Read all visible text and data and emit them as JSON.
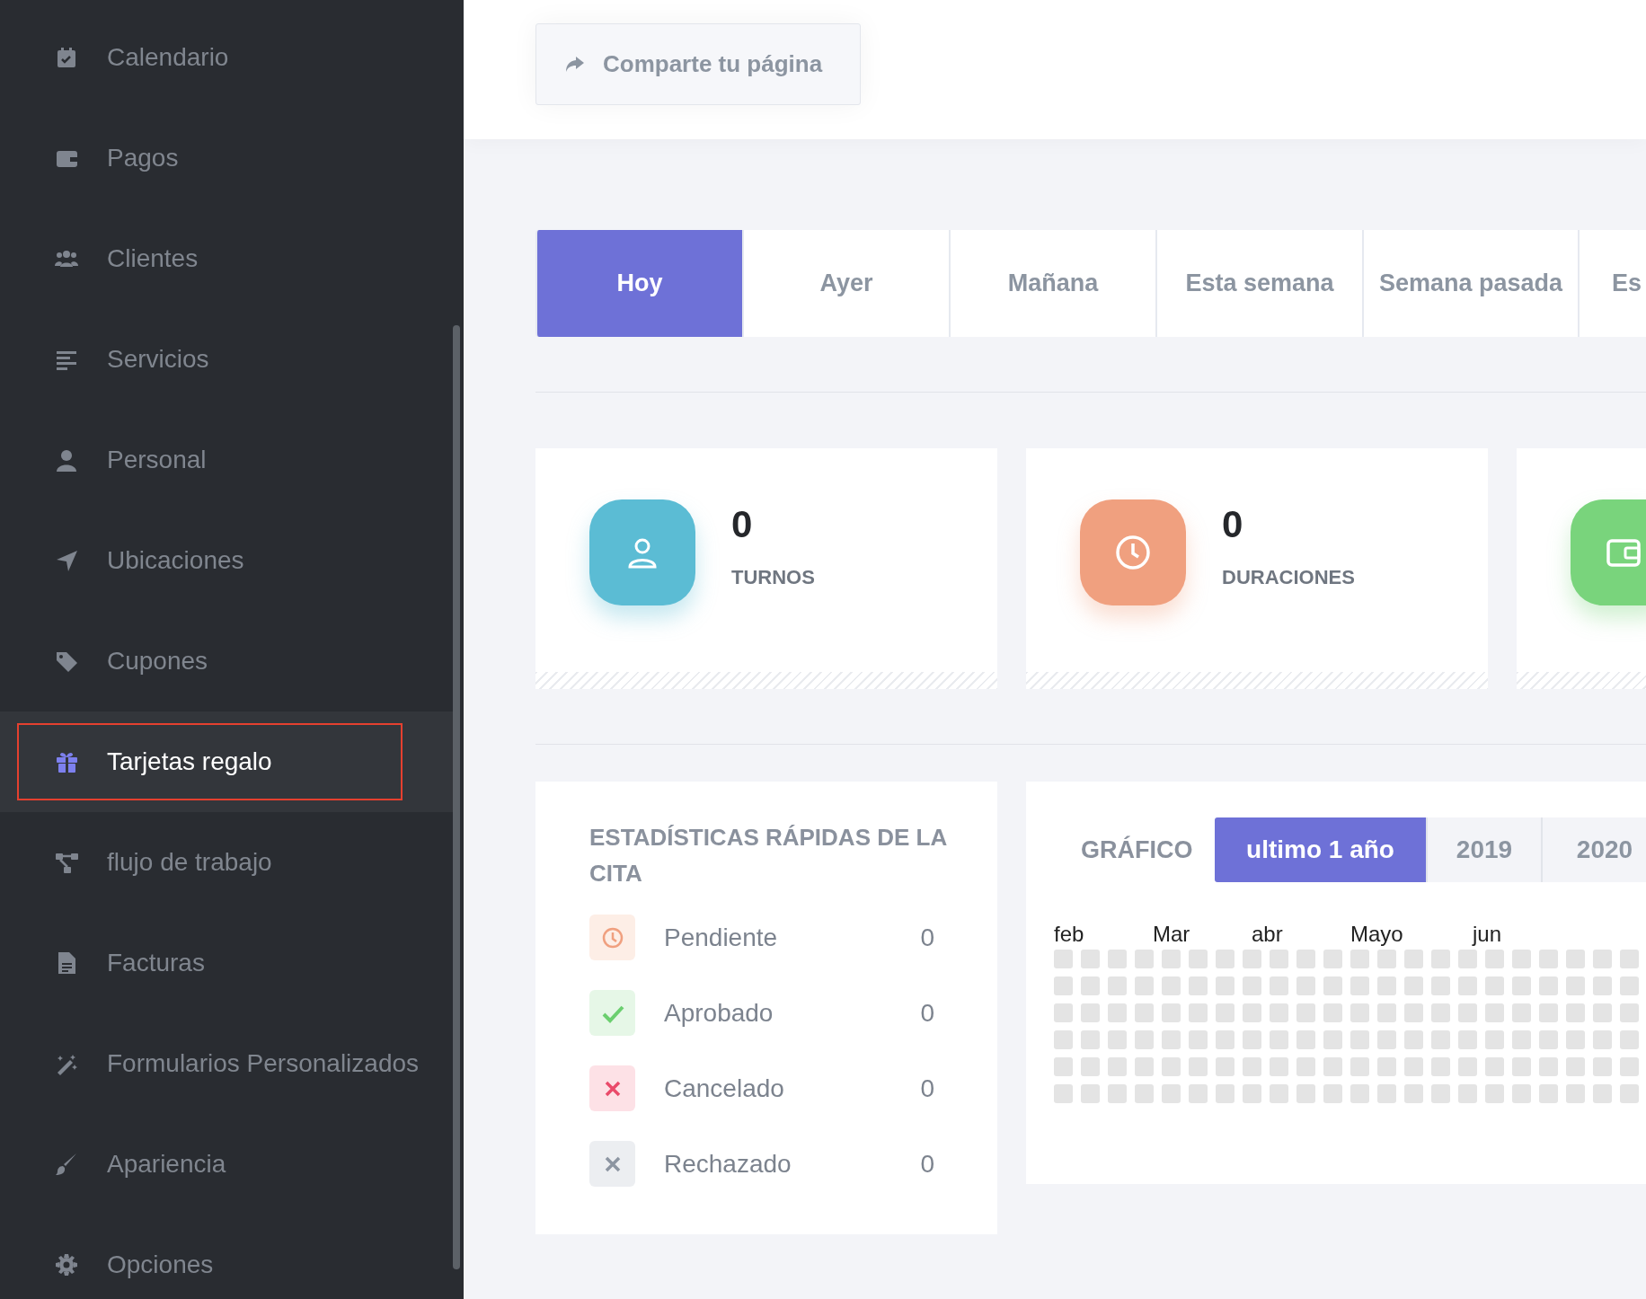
{
  "sidebar": {
    "items": [
      {
        "label": "Calendario",
        "selected": false
      },
      {
        "label": "Pagos",
        "selected": false
      },
      {
        "label": "Clientes",
        "selected": false
      },
      {
        "label": "Servicios",
        "selected": false
      },
      {
        "label": "Personal",
        "selected": false
      },
      {
        "label": "Ubicaciones",
        "selected": false
      },
      {
        "label": "Cupones",
        "selected": false
      },
      {
        "label": "Tarjetas regalo",
        "selected": true
      },
      {
        "label": "flujo de trabajo",
        "selected": false
      },
      {
        "label": "Facturas",
        "selected": false
      },
      {
        "label": "Formularios Personalizados",
        "selected": false
      },
      {
        "label": "Apariencia",
        "selected": false
      },
      {
        "label": "Opciones",
        "selected": false
      }
    ]
  },
  "header": {
    "share_button": "Comparte tu página"
  },
  "period_tabs": [
    {
      "label": "Hoy",
      "selected": true
    },
    {
      "label": "Ayer",
      "selected": false
    },
    {
      "label": "Mañana",
      "selected": false
    },
    {
      "label": "Esta semana",
      "selected": false
    },
    {
      "label": "Semana pasada",
      "selected": false
    },
    {
      "label": "Es",
      "selected": false
    }
  ],
  "stat_cards": [
    {
      "kind": "person",
      "value": "0",
      "label": "TURNOS"
    },
    {
      "kind": "clock",
      "value": "0",
      "label": "DURACIONES"
    },
    {
      "kind": "wallet"
    }
  ],
  "quick_stats": {
    "title": "ESTADÍSTICAS RÁPIDAS DE LA CITA",
    "rows": [
      {
        "kind": "pending",
        "label": "Pendiente",
        "value": "0"
      },
      {
        "kind": "approved",
        "label": "Aprobado",
        "value": "0"
      },
      {
        "kind": "cancelled",
        "label": "Cancelado",
        "value": "0"
      },
      {
        "kind": "rejected",
        "label": "Rechazado",
        "value": "0"
      }
    ]
  },
  "chart_panel": {
    "title": "GRÁFICO",
    "tabs": [
      {
        "label": "ultimo 1 año",
        "selected": true
      },
      {
        "label": "2019",
        "selected": false
      },
      {
        "label": "2020",
        "selected": false
      }
    ],
    "months": [
      "feb",
      "Mar",
      "abr",
      "Mayo",
      "jun"
    ]
  }
}
